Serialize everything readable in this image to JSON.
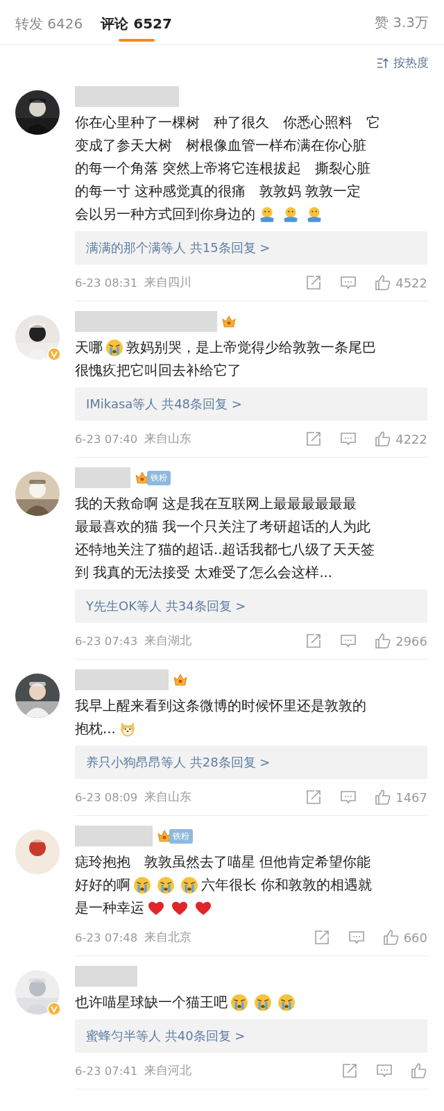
{
  "tabs": [
    {
      "label": "转发",
      "count": "6426",
      "selected": false
    },
    {
      "label": "评论",
      "count": "6527",
      "selected": true
    }
  ],
  "like_total": {
    "label": "赞",
    "count": "3.3万"
  },
  "sort": {
    "label": "按热度"
  },
  "comments": [
    {
      "verified": false,
      "lines": [
        [
          {
            "kind": "text",
            "text": "你在心里种了一棵树　种了很久　你悉心照料　它"
          }
        ],
        [
          {
            "kind": "text",
            "text": "变成了参天大树　树根像血管一样布满在你心脏"
          }
        ],
        [
          {
            "kind": "text",
            "text": "的每一个角落 突然上帝将它连根拔起　撕裂心脏"
          }
        ],
        [
          {
            "kind": "text",
            "text": "的每一寸 这种感觉真的很痛　敦敦妈 敦敦一定"
          }
        ],
        [
          {
            "kind": "text",
            "text": "会以另一种方式回到你身边的"
          },
          {
            "kind": "hug"
          },
          {
            "kind": "hug"
          },
          {
            "kind": "hug"
          }
        ]
      ],
      "replies": {
        "names": "满满的那个满等人",
        "total": "共15条回复 >"
      },
      "date": "6-23 08:31",
      "location": "来自四川",
      "likes": "4522"
    },
    {
      "verified": true,
      "badge": {
        "kind": "crown"
      },
      "lines": [
        [
          {
            "kind": "text",
            "text": "天哪"
          },
          {
            "kind": "cry"
          },
          {
            "kind": "text",
            "text": "敦妈别哭，是上帝觉得少给敦敦一条尾巴"
          }
        ],
        [
          {
            "kind": "text",
            "text": "很愧疚把它叫回去补给它了"
          }
        ]
      ],
      "replies": {
        "names": "IMikasa等人",
        "total": "共48条回复 >"
      },
      "date": "6-23 07:40",
      "location": "来自山东",
      "likes": "4222"
    },
    {
      "verified": false,
      "badge": {
        "kind": "fan",
        "label": "铁粉"
      },
      "lines": [
        [
          {
            "kind": "text",
            "text": "我的天救命啊 这是我在互联网上最最最最最最"
          }
        ],
        [
          {
            "kind": "text",
            "text": "最最喜欢的猫 我一个只关注了考研超话的人为此"
          }
        ],
        [
          {
            "kind": "text",
            "text": "还特地关注了猫的超话..超话我都七八级了天天签"
          }
        ],
        [
          {
            "kind": "text",
            "text": "到 我真的无法接受 太难受了怎么会这样..."
          }
        ]
      ],
      "replies": {
        "names": "Y先生OK等人",
        "total": "共34条回复 >"
      },
      "date": "6-23 07:43",
      "location": "来自湖北",
      "likes": "2966"
    },
    {
      "verified": false,
      "badge": {
        "kind": "crown"
      },
      "lines": [
        [
          {
            "kind": "text",
            "text": "我早上醒来看到这条微博的时候怀里还是敦敦的"
          }
        ],
        [
          {
            "kind": "text",
            "text": "抱枕..."
          },
          {
            "kind": "dog"
          }
        ]
      ],
      "replies": {
        "names": "养只小狗昂昂等人",
        "total": "共28条回复 >"
      },
      "date": "6-23 08:09",
      "location": "来自山东",
      "likes": "1467"
    },
    {
      "verified": false,
      "badge": {
        "kind": "fan",
        "label": "铁粉"
      },
      "lines": [
        [
          {
            "kind": "text",
            "text": "痣玲抱抱　敦敦虽然去了喵星 但他肯定希望你能"
          }
        ],
        [
          {
            "kind": "text",
            "text": "好好的啊"
          },
          {
            "kind": "cry"
          },
          {
            "kind": "cry"
          },
          {
            "kind": "cry"
          },
          {
            "kind": "text",
            "text": "六年很长 你和敦敦的相遇就"
          }
        ],
        [
          {
            "kind": "text",
            "text": "是一种幸运"
          },
          {
            "kind": "heart"
          },
          {
            "kind": "heart"
          },
          {
            "kind": "heart"
          }
        ]
      ],
      "date": "6-23 07:48",
      "location": "来自北京",
      "likes": "660"
    },
    {
      "verified": true,
      "lines": [
        [
          {
            "kind": "text",
            "text": "也许喵星球缺一个猫王吧"
          },
          {
            "kind": "cry"
          },
          {
            "kind": "cry"
          },
          {
            "kind": "cry"
          }
        ]
      ],
      "replies": {
        "names": "蜜蜂匀半等人",
        "total": "共40条回复 >"
      },
      "date": "6-23 07:41",
      "location": "来自河北"
    }
  ]
}
